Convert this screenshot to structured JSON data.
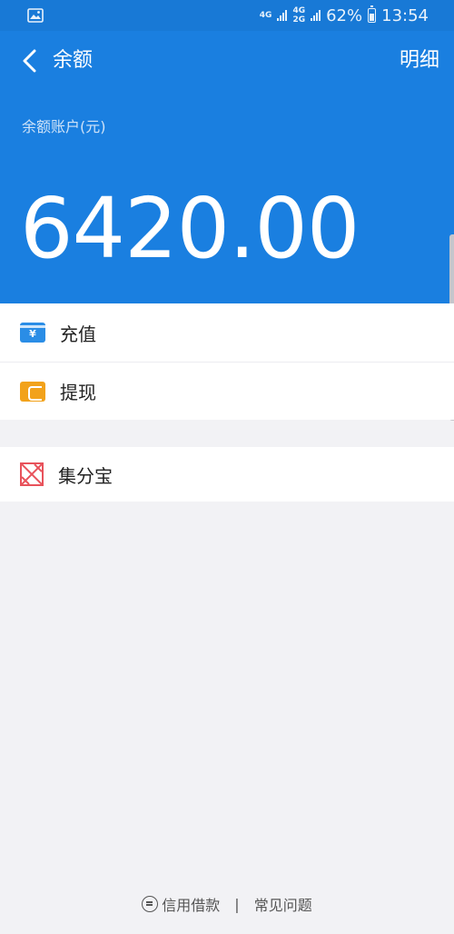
{
  "status_bar": {
    "network1": "4G",
    "network2_top": "4G",
    "network2_bottom": "2G",
    "battery": "62%",
    "time": "13:54"
  },
  "header": {
    "back_icon": "chevron-left-icon",
    "title": "余额",
    "detail_link": "明细",
    "account_label": "余额账户(元)",
    "balance": "6420.00",
    "background_color": "#1a7fe0"
  },
  "menu": {
    "items": [
      {
        "label": "充值",
        "icon": "recharge-icon",
        "icon_glyph": "¥",
        "color": "#2a8de6"
      },
      {
        "label": "提现",
        "icon": "withdraw-icon",
        "color": "#f2a21b"
      }
    ],
    "extra": [
      {
        "label": "集分宝",
        "icon": "jifenbao-icon",
        "color": "#e8525b"
      }
    ]
  },
  "footer": {
    "link1": "信用借款",
    "separator": "|",
    "link2": "常见问题"
  }
}
